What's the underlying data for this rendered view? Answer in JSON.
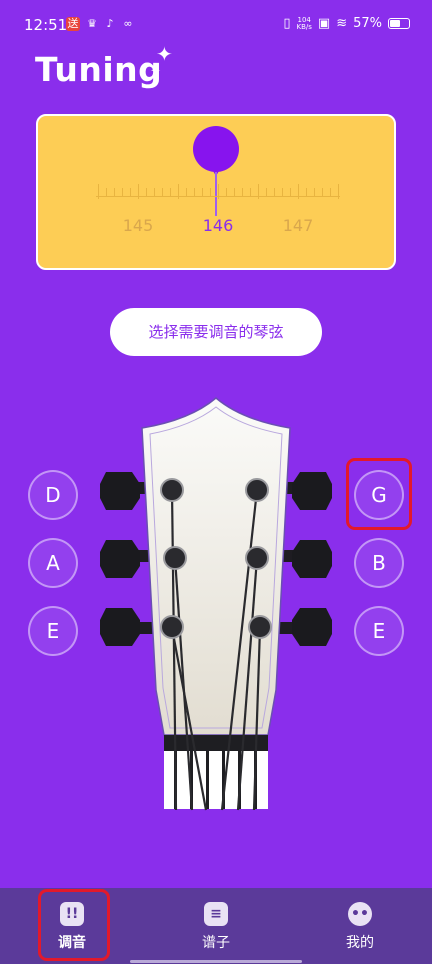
{
  "status_bar": {
    "time": "12:51",
    "speed_value": "104",
    "speed_unit": "KB/s",
    "battery": "57%",
    "battery_level": 0.57
  },
  "app_title": "Tuning",
  "tuner": {
    "scale_labels": [
      "145",
      "146",
      "147"
    ],
    "active_index": 1
  },
  "select_string_button": "选择需要调音的琴弦",
  "strings": {
    "left": [
      "D",
      "A",
      "E"
    ],
    "right": [
      "G",
      "B",
      "E"
    ]
  },
  "bottom_nav": {
    "items": [
      {
        "label": "调音",
        "icon": "tuning-icon",
        "active": true
      },
      {
        "label": "谱子",
        "icon": "sheet-music-icon",
        "active": false
      },
      {
        "label": "我的",
        "icon": "profile-icon",
        "active": false
      }
    ]
  },
  "colors": {
    "background": "#8a2eec",
    "tuner_panel": "#fdcd55",
    "indicator": "#8714ee",
    "nav_bar": "#5b3a9a",
    "highlight": "#e3192b"
  }
}
